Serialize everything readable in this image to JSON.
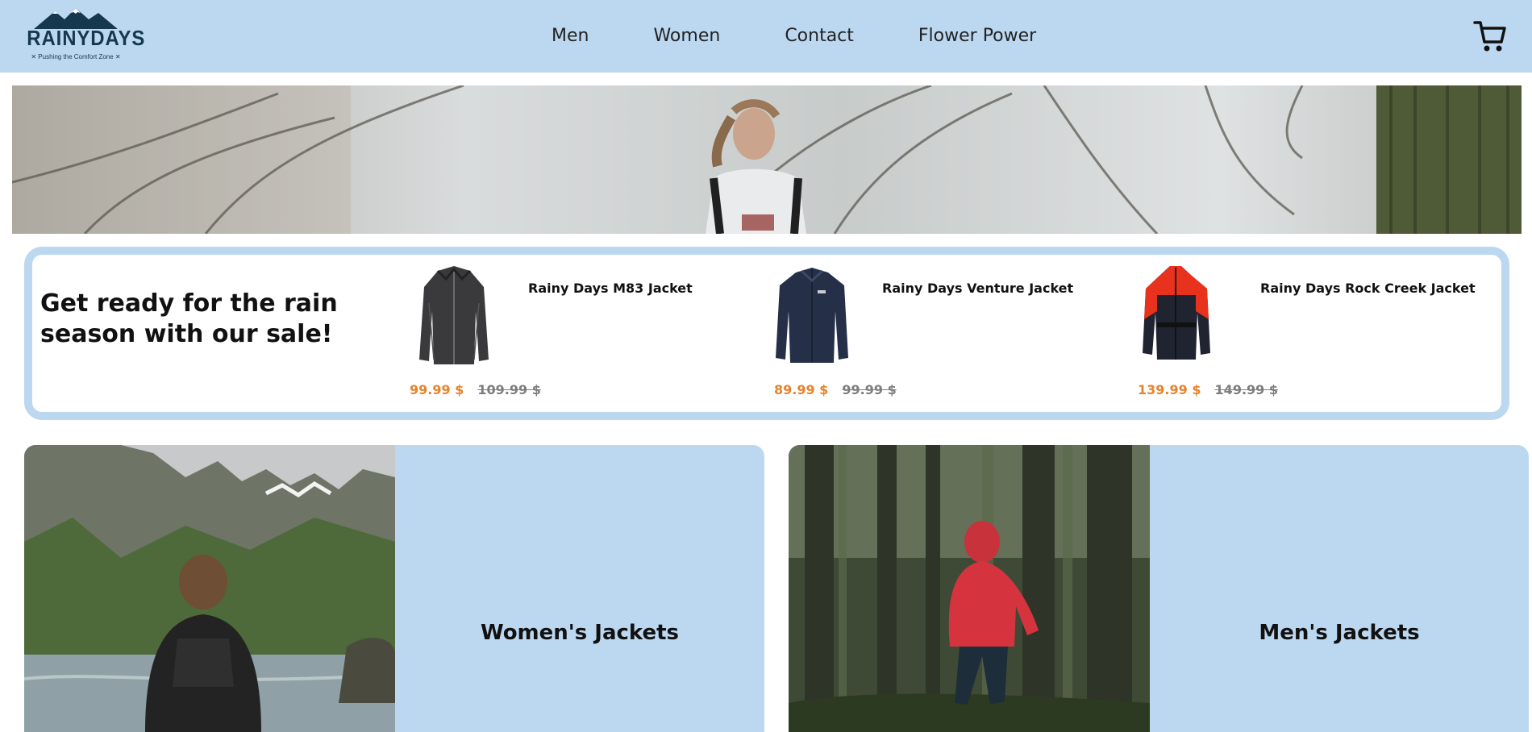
{
  "header": {
    "logo": {
      "text": "RAINYDAYS",
      "tagline": "✕ Pushing the Comfort Zone ✕"
    },
    "nav": [
      {
        "label": "Men"
      },
      {
        "label": "Women"
      },
      {
        "label": "Contact"
      },
      {
        "label": "Flower Power"
      }
    ],
    "cart_icon": "shopping-cart-icon"
  },
  "hero": {
    "image": "woman-running-in-misty-forest"
  },
  "sale": {
    "heading": "Get ready for the rain season with our sale!",
    "products": [
      {
        "name": "Rainy Days M83 Jacket",
        "price": "99.99 $",
        "old_price": "109.99 $",
        "image": "black-jacket"
      },
      {
        "name": "Rainy Days Venture Jacket",
        "price": "89.99 $",
        "old_price": "99.99 $",
        "image": "navy-fleece-jacket"
      },
      {
        "name": "Rainy Days Rock Creek Jacket",
        "price": "139.99 $",
        "old_price": "149.99 $",
        "image": "red-black-jacket"
      }
    ]
  },
  "categories": [
    {
      "title": "Women's Jackets",
      "image": "woman-by-mountain-lake"
    },
    {
      "title": "Men's Jackets",
      "image": "man-in-red-jacket-forest"
    }
  ],
  "colors": {
    "header_bg": "#bcd8f1",
    "accent_orange": "#e8822b",
    "old_price_gray": "#7d7d7d",
    "logo_navy": "#16384e"
  }
}
